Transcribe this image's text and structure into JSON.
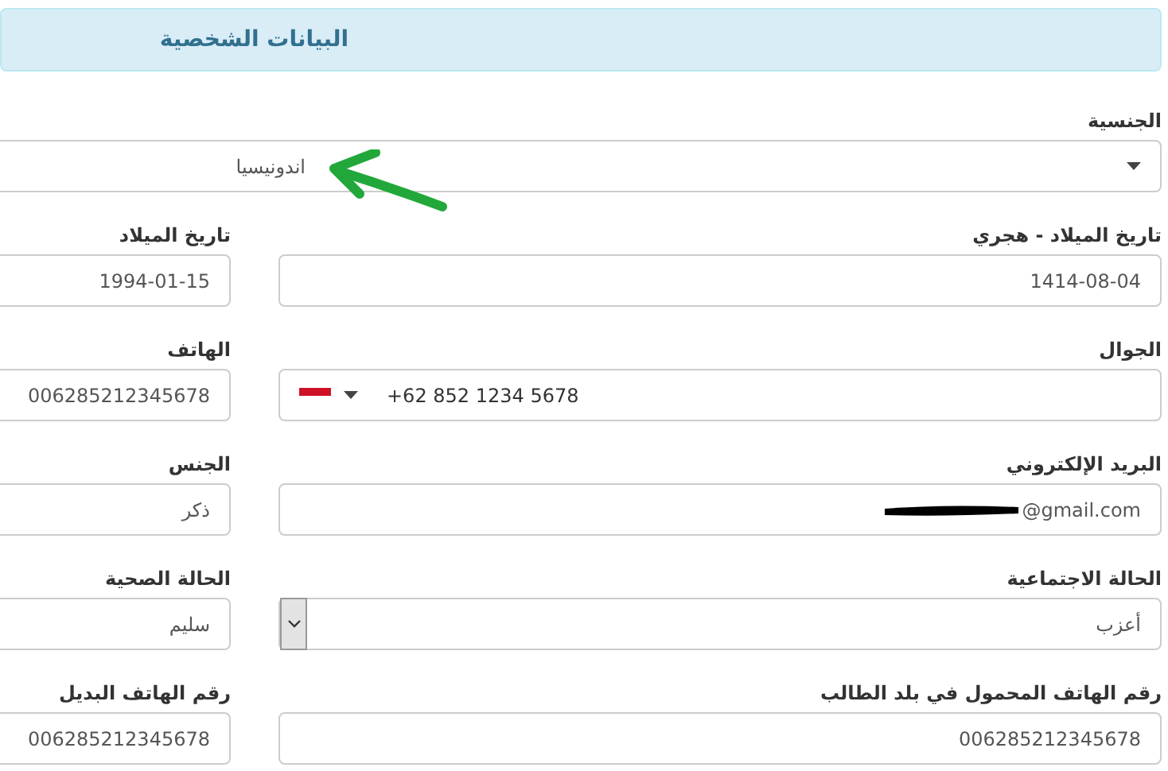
{
  "section_title": "البيانات الشخصية",
  "nationality": {
    "label": "الجنسية",
    "value": "اندونيسيا"
  },
  "rows": [
    [
      {
        "kind": "text",
        "label": "تاريخ الميلاد - هجري",
        "value": "1414-08-04"
      },
      {
        "kind": "text",
        "label": "تاريخ الميلاد",
        "value": "1994-01-15"
      }
    ],
    [
      {
        "kind": "phone",
        "label": "الجوال",
        "value": "+62 852 1234 5678"
      },
      {
        "kind": "text",
        "label": "الهاتف",
        "value": "006285212345678"
      }
    ],
    [
      {
        "kind": "redacted",
        "label": "البريد الإلكتروني",
        "value": "@gmail.com"
      },
      {
        "kind": "text",
        "label": "الجنس",
        "value": "ذكر"
      }
    ],
    [
      {
        "kind": "select",
        "label": "الحالة الاجتماعية",
        "value": "أعزب"
      },
      {
        "kind": "text",
        "label": "الحالة الصحية",
        "value": "سليم"
      }
    ],
    [
      {
        "kind": "text",
        "label": "رقم الهاتف المحمول في بلد الطالب",
        "value": "006285212345678"
      },
      {
        "kind": "text",
        "label": "رقم الهاتف البديل",
        "value": "006285212345678"
      }
    ]
  ]
}
